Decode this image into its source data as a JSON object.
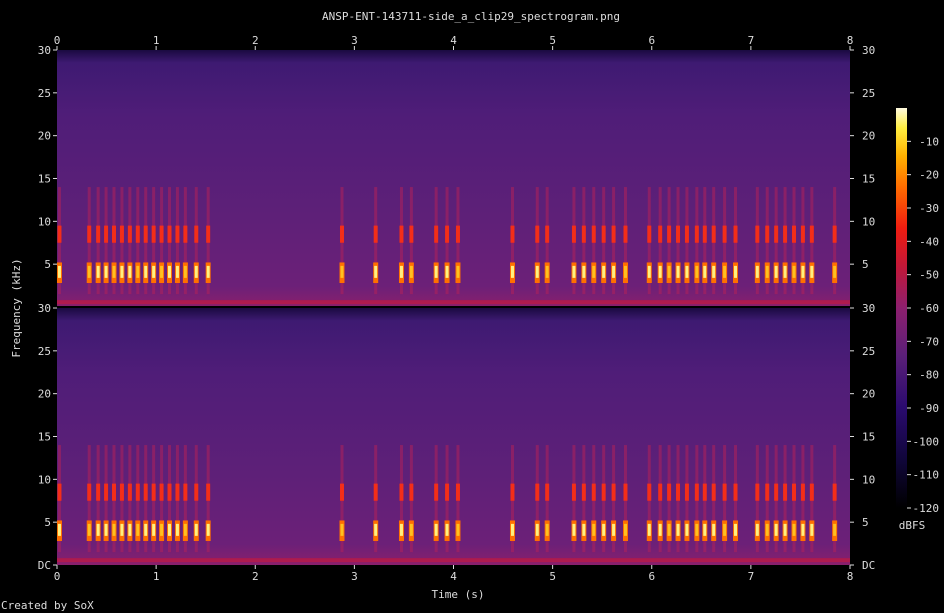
{
  "title": "ANSP-ENT-143711-side_a_clip29_spectrogram.png",
  "credit": "Created by SoX",
  "colors": {
    "background": "#000000",
    "text": "#dddddd",
    "floor_color": "#5a1f78",
    "peak_color": "#fffbe0"
  },
  "chart_data": {
    "type": "heatmap",
    "description_type": "spectrogram",
    "xlabel": "Time (s)",
    "ylabel": "Frequency (kHz)",
    "x_ticks": [
      "0",
      "1",
      "2",
      "3",
      "4",
      "5",
      "6",
      "7",
      "8"
    ],
    "y_ticks_top": [
      "5",
      "10",
      "15",
      "20",
      "25",
      "30"
    ],
    "y_ticks_bottom": [
      "DC",
      "5",
      "10",
      "15",
      "20",
      "25",
      "30"
    ],
    "xlim": [
      0,
      8
    ],
    "ylim_khz": [
      0,
      30
    ],
    "channels": 2,
    "colorbar": {
      "label": "dBFS",
      "ticks": [
        "-10",
        "-20",
        "-30",
        "-40",
        "-50",
        "-60",
        "-70",
        "-80",
        "-90",
        "-100",
        "-110",
        "-120"
      ],
      "range": [
        -120,
        0
      ]
    },
    "events_s": [
      0.02,
      0.32,
      0.41,
      0.49,
      0.57,
      0.65,
      0.73,
      0.81,
      0.89,
      0.97,
      1.05,
      1.13,
      1.21,
      1.29,
      1.4,
      1.52,
      2.87,
      3.21,
      3.47,
      3.57,
      3.82,
      3.93,
      4.04,
      4.59,
      4.84,
      4.94,
      5.21,
      5.31,
      5.41,
      5.51,
      5.61,
      5.73,
      5.97,
      6.08,
      6.17,
      6.26,
      6.35,
      6.45,
      6.53,
      6.62,
      6.73,
      6.84,
      7.06,
      7.16,
      7.25,
      7.34,
      7.43,
      7.52,
      7.61,
      7.84
    ],
    "dominant_bands_khz": [
      4,
      8.5
    ]
  }
}
